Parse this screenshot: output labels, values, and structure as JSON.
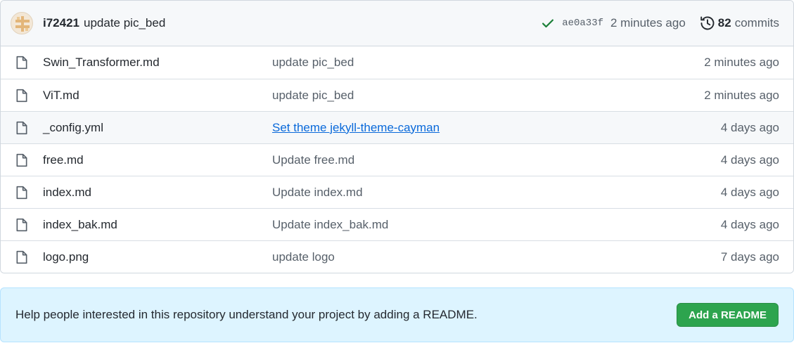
{
  "latest_commit": {
    "author": "i72421",
    "message": "update pic_bed",
    "sha": "ae0a33f",
    "age": "2 minutes ago",
    "commit_count": "82",
    "commits_label": "commits"
  },
  "files": [
    {
      "name": "Swin_Transformer.md",
      "message": "update pic_bed",
      "age": "2 minutes ago",
      "icon": "file-icon"
    },
    {
      "name": "ViT.md",
      "message": "update pic_bed",
      "age": "2 minutes ago",
      "icon": "file-icon"
    },
    {
      "name": "_config.yml",
      "message": "Set theme jekyll-theme-cayman",
      "age": "4 days ago",
      "icon": "file-icon"
    },
    {
      "name": "free.md",
      "message": "Update free.md",
      "age": "4 days ago",
      "icon": "file-icon"
    },
    {
      "name": "index.md",
      "message": "Update index.md",
      "age": "4 days ago",
      "icon": "file-icon"
    },
    {
      "name": "index_bak.md",
      "message": "Update index_bak.md",
      "age": "4 days ago",
      "icon": "file-icon"
    },
    {
      "name": "logo.png",
      "message": "update logo",
      "age": "7 days ago",
      "icon": "file-icon"
    }
  ],
  "readme_prompt": {
    "text": "Help people interested in this repository understand your project by adding a README.",
    "button_label": "Add a README"
  },
  "colors": {
    "success": "#1a7f37",
    "link": "#0969da",
    "button": "#2da44e",
    "banner": "#ddf4ff"
  }
}
